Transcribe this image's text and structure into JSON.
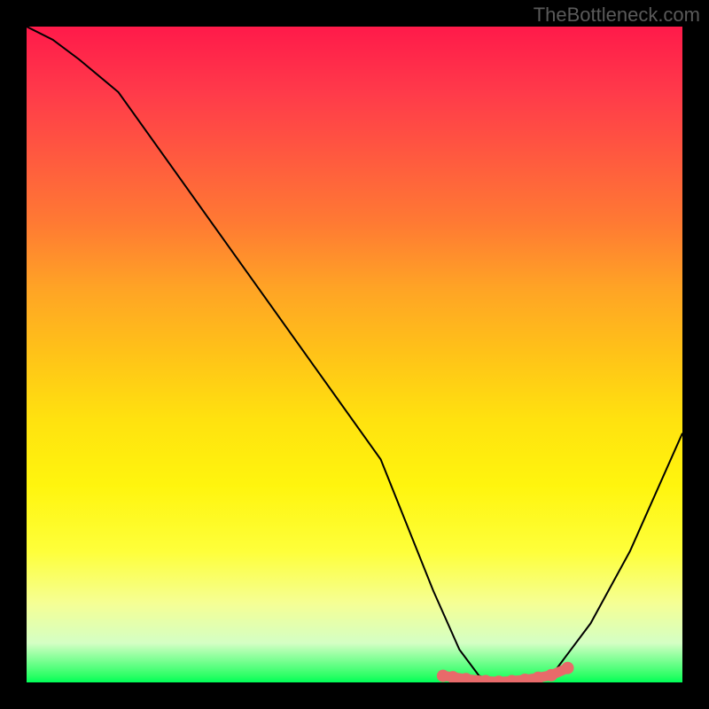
{
  "watermark": "TheBottleneck.com",
  "chart_data": {
    "type": "line",
    "title": "",
    "xlabel": "",
    "ylabel": "",
    "xlim": [
      0,
      100
    ],
    "ylim": [
      0,
      100
    ],
    "grid": false,
    "legend": false,
    "series": [
      {
        "name": "bottleneck-curve",
        "x": [
          0,
          4,
          8,
          14,
          24,
          34,
          44,
          54,
          58,
          62,
          66,
          69,
          72,
          80,
          86,
          92,
          100
        ],
        "y": [
          100,
          98,
          95,
          90,
          76,
          62,
          48,
          34,
          24,
          14,
          5,
          1,
          0,
          1,
          9,
          20,
          38
        ],
        "color": "#000000",
        "stroke_width": 2
      },
      {
        "name": "optimal-zone-markers",
        "x": [
          63.5,
          65,
          67,
          70,
          72,
          74,
          76,
          78,
          80,
          82.5
        ],
        "y": [
          1.0,
          0.8,
          0.5,
          0.2,
          0.1,
          0.2,
          0.4,
          0.7,
          1.1,
          2.2
        ],
        "color": "#e86a6a",
        "marker_size": 7
      }
    ],
    "background": {
      "type": "vertical-gradient",
      "stops": [
        {
          "pos": 0.0,
          "color": "#ff1a4a"
        },
        {
          "pos": 0.5,
          "color": "#ffc318"
        },
        {
          "pos": 0.88,
          "color": "#f5ff95"
        },
        {
          "pos": 1.0,
          "color": "#00ff58"
        }
      ]
    }
  }
}
